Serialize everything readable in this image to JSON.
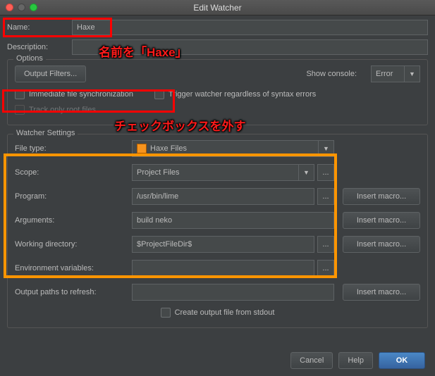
{
  "window": {
    "title": "Edit Watcher"
  },
  "fields": {
    "name_label": "Name:",
    "name_value": "Haxe",
    "description_label": "Description:",
    "description_value": ""
  },
  "options": {
    "legend": "Options",
    "output_filters_btn": "Output Filters...",
    "show_console_label": "Show console:",
    "show_console_value": "Error",
    "immediate_sync": "Immediate file synchronization",
    "trigger_regardless": "Trigger watcher regardless of syntax errors",
    "track_root": "Track only root files"
  },
  "watcher": {
    "legend": "Watcher Settings",
    "file_type_label": "File type:",
    "file_type_value": "Haxe Files",
    "scope_label": "Scope:",
    "scope_value": "Project Files",
    "program_label": "Program:",
    "program_value": "/usr/bin/lime",
    "arguments_label": "Arguments:",
    "arguments_value": "build neko",
    "workdir_label": "Working directory:",
    "workdir_value": "$ProjectFileDir$",
    "env_label": "Environment variables:",
    "env_value": "",
    "output_paths_label": "Output paths to refresh:",
    "output_paths_value": "",
    "create_output_stdout": "Create output file from stdout",
    "insert_macro": "Insert macro..."
  },
  "buttons": {
    "cancel": "Cancel",
    "help": "Help",
    "ok": "OK"
  },
  "annotations": {
    "name_anno": "名前を「Haxe」",
    "checkbox_anno": "チェックボックスを外す"
  }
}
